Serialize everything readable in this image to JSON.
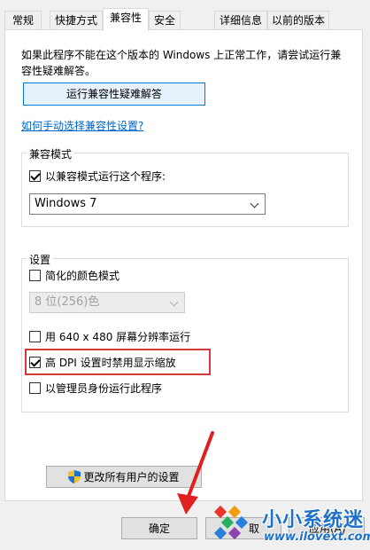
{
  "tabs": [
    {
      "label": "常规"
    },
    {
      "label": "快捷方式"
    },
    {
      "label": "兼容性"
    },
    {
      "label": "安全"
    },
    {
      "label": "详细信息"
    },
    {
      "label": "以前的版本"
    }
  ],
  "intro": "如果此程序不能在这个版本的 Windows 上正常工作，请尝试运行兼容性疑难解答。",
  "troubleshoot_button": "运行兼容性疑难解答",
  "manual_link": "如何手动选择兼容性设置?",
  "compat_mode": {
    "title": "兼容模式",
    "checkbox_label": "以兼容模式运行这个程序:",
    "checked": true,
    "selected_os": "Windows 7"
  },
  "settings": {
    "title": "设置",
    "reduced_color": {
      "label": "简化的颜色模式",
      "checked": false
    },
    "color_select": "8 位(256)色",
    "res640": {
      "label": "用 640 x 480 屏幕分辨率运行",
      "checked": false
    },
    "high_dpi": {
      "label": "高 DPI 设置时禁用显示缩放",
      "checked": true
    },
    "admin": {
      "label": "以管理员身份运行此程序",
      "checked": false
    }
  },
  "all_users_button": "更改所有用户的设置",
  "ok_button": "确定",
  "cancel_button_partial": "取",
  "apply_button_partial": "应用(A)",
  "watermark": {
    "title": "小小系统迷",
    "url": "www.ilovext.com"
  },
  "colors": {
    "accent": "#0078d7",
    "highlight": "#d83a3a",
    "link": "#0066cc"
  }
}
